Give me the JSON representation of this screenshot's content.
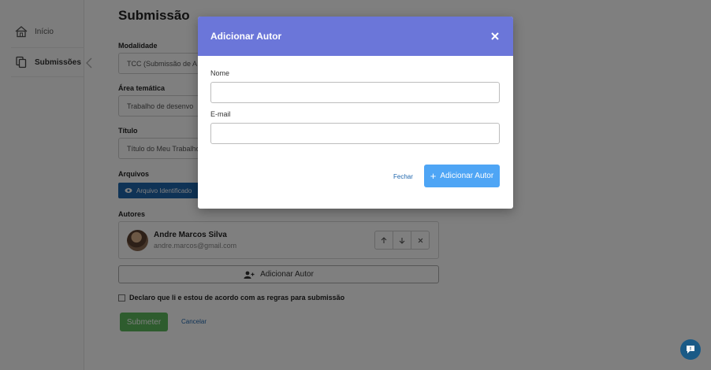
{
  "sidebar": {
    "items": [
      {
        "label": "Início",
        "icon": "home-icon"
      },
      {
        "label": "Submissões",
        "icon": "documents-icon"
      }
    ]
  },
  "page": {
    "title": "Submissão",
    "modalidade_label": "Modalidade",
    "modalidade_value": "TCC (Submissão de A",
    "area_label": "Área temática",
    "area_value": "Trabalho de desenvo",
    "titulo_label": "Título",
    "titulo_value": "Título do Meu Trabalho",
    "arquivos_label": "Arquivos",
    "arquivo_badge": "Arquivo Identificado",
    "autores_label": "Autores",
    "author": {
      "name": "Andre Marcos Silva",
      "email": "andre.marcos@gmail.com"
    },
    "add_author_label": "Adicionar Autor",
    "agree_label": "Declaro que li e estou de acordo com as regras para submissão",
    "submit_label": "Submeter",
    "cancel_label": "Cancelar"
  },
  "modal": {
    "title": "Adicionar Autor",
    "nome_label": "Nome",
    "nome_value": "",
    "email_label": "E-mail",
    "email_value": "",
    "fechar_label": "Fechar",
    "add_label": "Adicionar Autor"
  },
  "colors": {
    "modal_header": "#6b76d9",
    "primary_button": "#4ea5f5",
    "submit_button": "#5cb85c",
    "link": "#1f66ad"
  }
}
